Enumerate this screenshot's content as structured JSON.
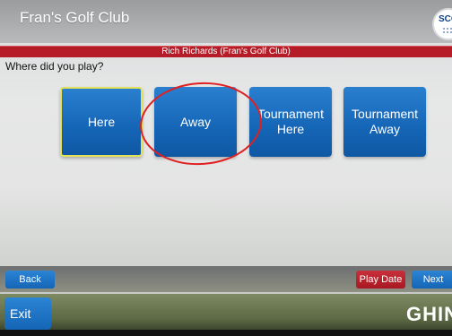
{
  "header": {
    "club_title": "Fran's Golf Club",
    "logo_text": "SCG"
  },
  "user_bar": {
    "text": "Rich Richards (Fran's Golf Club)"
  },
  "question": "Where did you play?",
  "options": [
    {
      "label": "Here",
      "selected": true
    },
    {
      "label": "Away",
      "selected": false,
      "annotated": true
    },
    {
      "label": "Tournament\nHere",
      "selected": false
    },
    {
      "label": "Tournament\nAway",
      "selected": false
    }
  ],
  "bottom": {
    "back_label": "Back",
    "play_date_label": "Play Date",
    "next_label": "Next",
    "exit_label": "Exit",
    "brand": "GHIN"
  },
  "colors": {
    "accent_blue": "#1565b6",
    "header_red": "#b51c27",
    "annotation_red": "#e02020",
    "selected_border": "#e3e05a"
  }
}
